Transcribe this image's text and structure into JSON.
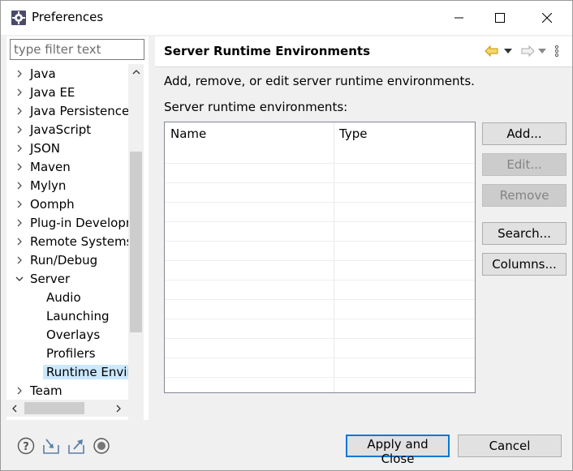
{
  "window": {
    "title": "Preferences",
    "icon": "eclipse-preferences-icon"
  },
  "filter": {
    "placeholder": "type filter text",
    "value": ""
  },
  "tree": {
    "items": [
      {
        "label": "Java",
        "expanded": false
      },
      {
        "label": "Java EE",
        "expanded": false
      },
      {
        "label": "Java Persistence",
        "expanded": false
      },
      {
        "label": "JavaScript",
        "expanded": false
      },
      {
        "label": "JSON",
        "expanded": false
      },
      {
        "label": "Maven",
        "expanded": false
      },
      {
        "label": "Mylyn",
        "expanded": false
      },
      {
        "label": "Oomph",
        "expanded": false
      },
      {
        "label": "Plug-in Developr",
        "expanded": false
      },
      {
        "label": "Remote Systems",
        "expanded": false
      },
      {
        "label": "Run/Debug",
        "expanded": false
      },
      {
        "label": "Server",
        "expanded": true
      },
      {
        "label": "Team",
        "expanded": false
      }
    ],
    "server_children": [
      {
        "label": "Audio"
      },
      {
        "label": "Launching"
      },
      {
        "label": "Overlays"
      },
      {
        "label": "Profilers"
      },
      {
        "label": "Runtime Envir",
        "selected": true
      }
    ]
  },
  "page": {
    "title": "Server Runtime Environments",
    "description": "Add, remove, or edit server runtime environments.",
    "list_label": "Server runtime environments:",
    "columns": [
      "Name",
      "Type"
    ],
    "rows": []
  },
  "buttons": {
    "add": {
      "label": "Add...",
      "enabled": true
    },
    "edit": {
      "label": "Edit...",
      "enabled": false
    },
    "remove": {
      "label": "Remove",
      "enabled": false
    },
    "search": {
      "label": "Search...",
      "enabled": true
    },
    "columns": {
      "label": "Columns...",
      "enabled": true
    }
  },
  "footer": {
    "apply_close": "Apply and Close",
    "cancel": "Cancel"
  },
  "colors": {
    "accent": "#0078d7",
    "selection": "#cce8ff",
    "nav_arrow": "#e0a000"
  }
}
